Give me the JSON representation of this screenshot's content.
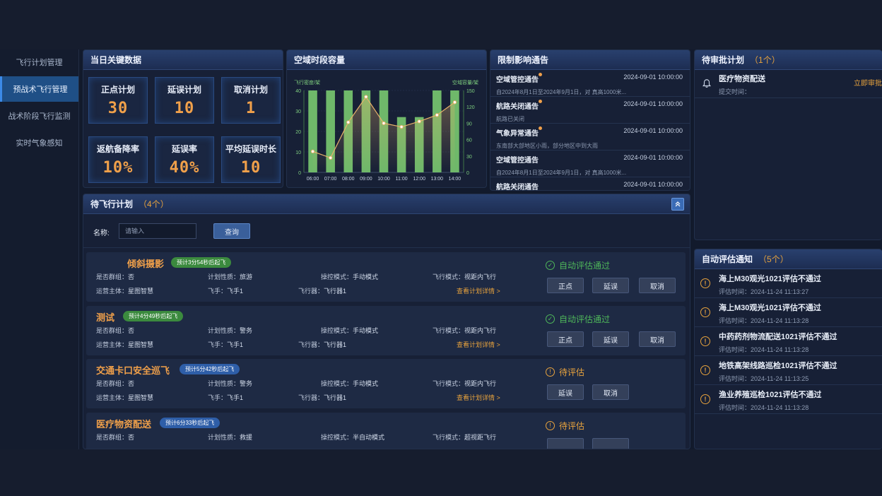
{
  "sidebar": {
    "items": [
      {
        "label": "飞行计划管理"
      },
      {
        "label": "预战术飞行管理"
      },
      {
        "label": "战术阶段飞行监测"
      },
      {
        "label": "实时气象感知"
      }
    ]
  },
  "kpi": {
    "title": "当日关键数据",
    "items": [
      {
        "label": "正点计划",
        "value": "30"
      },
      {
        "label": "延误计划",
        "value": "10"
      },
      {
        "label": "取消计划",
        "value": "1"
      },
      {
        "label": "返航备降率",
        "value": "10%"
      },
      {
        "label": "延误率",
        "value": "40%"
      },
      {
        "label": "平均延误时长",
        "value": "10"
      }
    ]
  },
  "capacity": {
    "title": "空域时段容量",
    "left_axis_label": "飞行密度/架",
    "right_axis_label": "空域容量/架"
  },
  "chart_data": {
    "type": "bar",
    "categories": [
      "06:00",
      "07:00",
      "08:00",
      "09:00",
      "10:00",
      "11:00",
      "12:00",
      "13:00",
      "14:00"
    ],
    "series": [
      {
        "name": "飞行密度/架",
        "type": "bar",
        "axis": "left",
        "values": [
          40,
          40,
          40,
          40,
          40,
          27,
          27,
          40,
          40
        ],
        "color": "#6fb86a"
      },
      {
        "name": "空域容量/架",
        "type": "line",
        "axis": "right",
        "values": [
          23,
          16,
          55,
          83,
          54,
          50,
          56,
          63,
          77
        ],
        "color": "#e8b26a"
      }
    ],
    "ylabel_left": "飞行密度/架",
    "ylabel_right": "空域容量/架",
    "ylim_left": [
      0,
      40
    ],
    "ylim_right": [
      0,
      90
    ],
    "yticks_left": [
      "0",
      "10",
      "20",
      "30",
      "40"
    ],
    "yticks_right": [
      "0",
      "30",
      "60",
      "90",
      "120",
      "150"
    ]
  },
  "notices": {
    "title": "限制影响通告",
    "items": [
      {
        "title": "空域管控通告",
        "time": "2024-09-01 10:00:00",
        "desc": "自2024年8月1日至2024年9月1日，对               真高1000米..."
      },
      {
        "title": "航路关闭通告",
        "time": "2024-09-01 10:00:00",
        "desc": "                    航路已关闭"
      },
      {
        "title": "气象异常通告",
        "time": "2024-09-01 10:00:00",
        "desc": "            东南部大部地区小雨，部分地区中到大雨"
      },
      {
        "title": "空域管控通告",
        "time": "2024-09-01 10:00:00",
        "desc": "自2024年8月1日至2024年9月1日，对               真高1000米..."
      },
      {
        "title": "航路关闭通告",
        "time": "2024-09-01 10:00:00",
        "desc": ""
      }
    ]
  },
  "approvals": {
    "title": "待审批计划",
    "count": "（1个）",
    "items": [
      {
        "name": "医疗物资配送",
        "submit_label": "提交时间：",
        "action": "立即审批"
      }
    ]
  },
  "pending": {
    "title": "待飞行计划",
    "count": "（4个）",
    "search_label": "名称:",
    "search_placeholder": "请输入",
    "search_button": "查询",
    "labels": {
      "group": "是否群组：",
      "nature": "计划性质：",
      "control": "操控模式：",
      "flight_mode": "飞行模式：",
      "operator": "运营主体：",
      "pilot": "飞手：",
      "aircraft": "飞行器：",
      "detail": "查看计划详情 >"
    },
    "plans": [
      {
        "title": "倾斜摄影",
        "badge": "预计3分54秒后起飞",
        "badge_color": "green",
        "group": "否",
        "nature": "旅游",
        "control": "手动模式",
        "flight_mode": "视距内飞行",
        "operator": "星图智慧",
        "pilot": "飞手1",
        "aircraft": "飞行器1",
        "status": "自动评估通过",
        "status_type": "ok",
        "buttons": [
          "正点",
          "延误",
          "取消"
        ]
      },
      {
        "title": "测试",
        "badge": "预计4分49秒后起飞",
        "badge_color": "green",
        "group": "否",
        "nature": "警务",
        "control": "手动模式",
        "flight_mode": "视距内飞行",
        "operator": "星图智慧",
        "pilot": "飞手1",
        "aircraft": "飞行器1",
        "status": "自动评估通过",
        "status_type": "ok",
        "buttons": [
          "正点",
          "延误",
          "取消"
        ]
      },
      {
        "title": "交通卡口安全巡飞",
        "badge": "预计5分42秒后起飞",
        "badge_color": "blue",
        "group": "否",
        "nature": "警务",
        "control": "手动模式",
        "flight_mode": "视距内飞行",
        "operator": "星图智慧",
        "pilot": "飞手1",
        "aircraft": "飞行器1",
        "status": "待评估",
        "status_type": "wait",
        "buttons": [
          "延误",
          "取消"
        ]
      },
      {
        "title": "医疗物资配送",
        "badge": "预计6分33秒后起飞",
        "badge_color": "blue",
        "group": "否",
        "nature": "救援",
        "control": "半自动模式",
        "flight_mode": "超视距飞行",
        "status": "待评估",
        "status_type": "wait"
      }
    ]
  },
  "evaluations": {
    "title": "自动评估通知",
    "count": "（5个）",
    "time_label": "评估时间：",
    "items": [
      {
        "title": "海上M30观光1021评估不通过",
        "time": "2024-11-24 11:13:27"
      },
      {
        "title": "海上M30观光1021评估不通过",
        "time": "2024-11-24 11:13:28"
      },
      {
        "title": "中药药剂物流配送1021评估不通过",
        "time": "2024-11-24 11:13:28"
      },
      {
        "title": "地铁高架线路巡检1021评估不通过",
        "time": "2024-11-24 11:13:25"
      },
      {
        "title": "渔业养殖巡检1021评估不通过",
        "time": "2024-11-24 11:13:28"
      }
    ]
  },
  "colors": {
    "accent": "#e8a33d",
    "ok": "#4fb85a",
    "header": "#29406e",
    "bar": "#6fb86a"
  }
}
